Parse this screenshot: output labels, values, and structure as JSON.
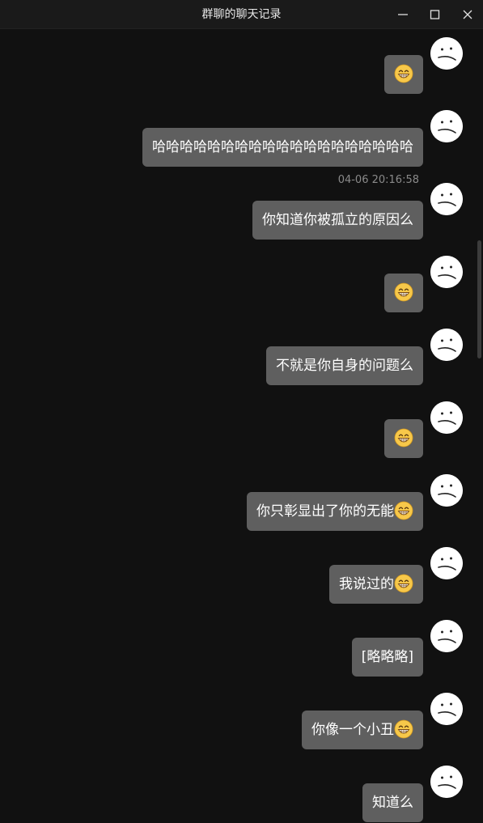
{
  "window": {
    "title": "群聊的聊天记录",
    "controls": [
      "minimize-icon",
      "maximize-icon",
      "close-icon"
    ]
  },
  "colors": {
    "background": "#111111",
    "bubble": "#5f5f5f",
    "timestamp": "#8a8a8a"
  },
  "messages": [
    {
      "text": "",
      "emoji": "grinning-face-icon"
    },
    {
      "text": "哈哈哈哈哈哈哈哈哈哈哈哈哈哈哈哈哈哈哈",
      "emoji": ""
    },
    {
      "text": "你知道你被孤立的原因么",
      "emoji": "",
      "timestamp": "04-06 20:16:58"
    },
    {
      "text": "",
      "emoji": "grinning-face-icon"
    },
    {
      "text": "不就是你自身的问题么",
      "emoji": ""
    },
    {
      "text": "",
      "emoji": "grinning-face-icon"
    },
    {
      "text": "你只彰显出了你的无能",
      "emoji": "grinning-face-icon"
    },
    {
      "text": "我说过的",
      "emoji": "grinning-face-icon"
    },
    {
      "text": "[略略略]",
      "emoji": ""
    },
    {
      "text": "你像一个小丑",
      "emoji": "grinning-face-icon"
    },
    {
      "text": "知道么",
      "emoji": ""
    }
  ]
}
